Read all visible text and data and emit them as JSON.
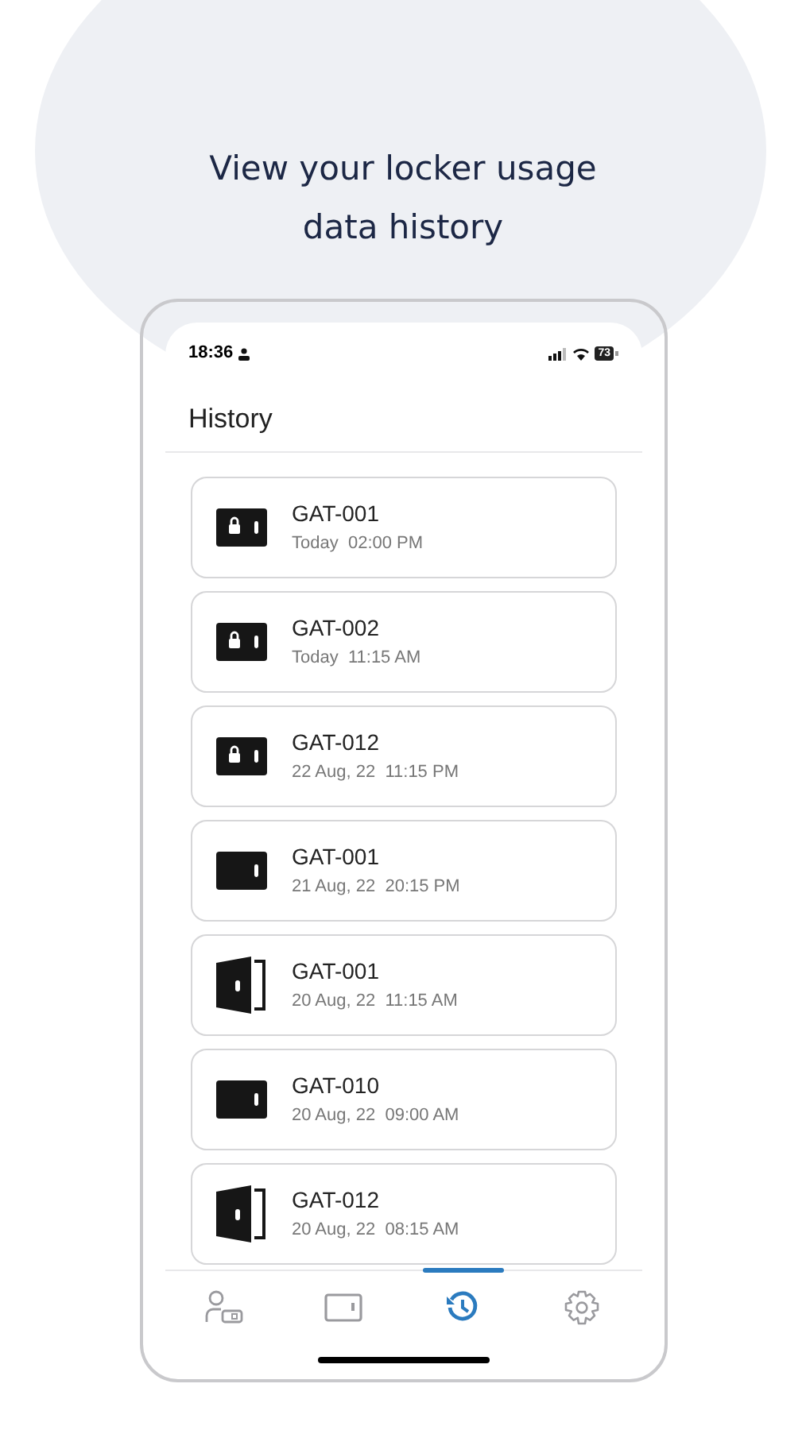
{
  "headline": "View your locker usage data history",
  "status_bar": {
    "time": "18:36",
    "battery": "73"
  },
  "title": "History",
  "history": [
    {
      "locker": "GAT-001",
      "time": "Today  02:00 PM",
      "kind": "locked"
    },
    {
      "locker": "GAT-002",
      "time": "Today  11:15 AM",
      "kind": "locked"
    },
    {
      "locker": "GAT-012",
      "time": "22 Aug, 22  11:15 PM",
      "kind": "locked"
    },
    {
      "locker": "GAT-001",
      "time": "21 Aug, 22  20:15 PM",
      "kind": "closed"
    },
    {
      "locker": "GAT-001",
      "time": "20 Aug, 22  11:15 AM",
      "kind": "open"
    },
    {
      "locker": "GAT-010",
      "time": "20 Aug, 22  09:00 AM",
      "kind": "closed"
    },
    {
      "locker": "GAT-012",
      "time": "20 Aug, 22  08:15 AM",
      "kind": "open"
    }
  ],
  "tabs": [
    {
      "kind": "account",
      "selected": false
    },
    {
      "kind": "locker",
      "selected": false
    },
    {
      "kind": "history",
      "selected": true
    },
    {
      "kind": "settings",
      "selected": false
    }
  ]
}
